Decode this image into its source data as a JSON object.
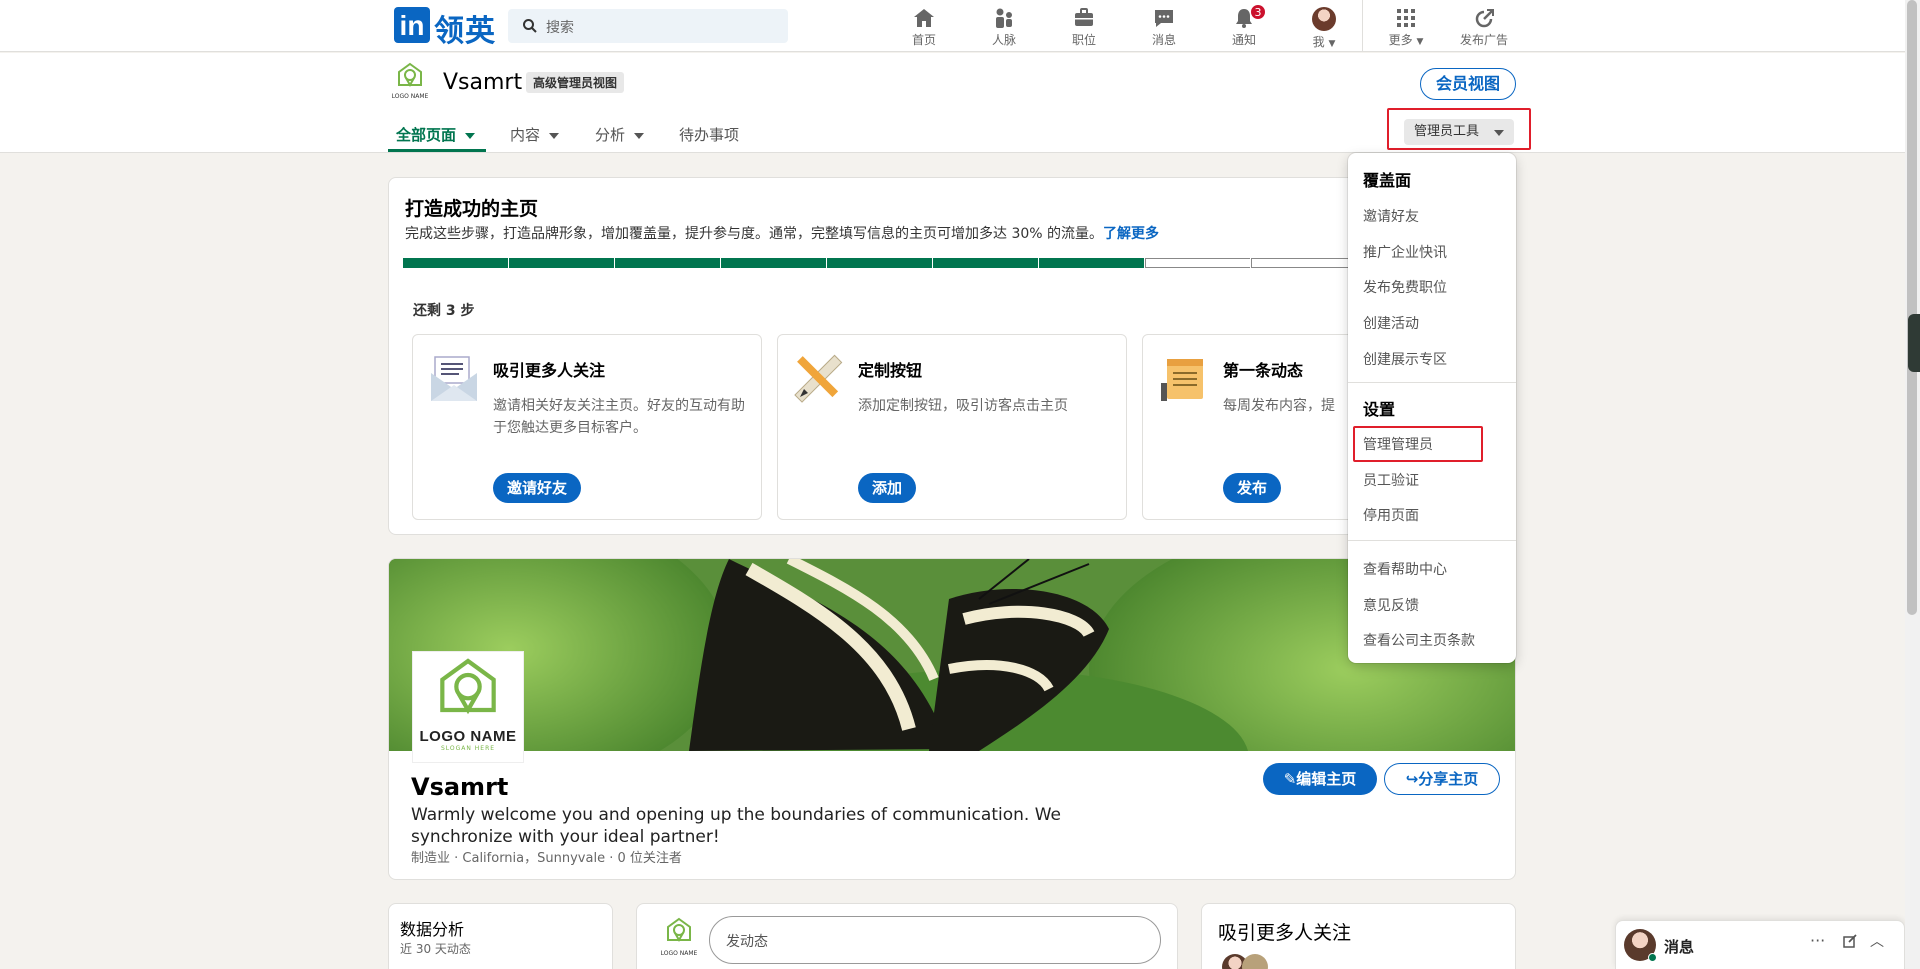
{
  "nav": {
    "logo_in": "in",
    "logo_text": "领英",
    "search_placeholder": "搜索",
    "items": [
      {
        "label": "首页",
        "icon": "home-icon"
      },
      {
        "label": "人脉",
        "icon": "network-icon"
      },
      {
        "label": "职位",
        "icon": "briefcase-icon"
      },
      {
        "label": "消息",
        "icon": "message-icon"
      },
      {
        "label": "通知",
        "icon": "bell-icon",
        "badge": "3"
      },
      {
        "label": "我",
        "icon": "avatar"
      },
      {
        "label": "更多",
        "icon": "grid-icon"
      },
      {
        "label": "发布广告",
        "icon": "ads-icon"
      }
    ]
  },
  "header": {
    "company_name": "Vsamrt",
    "view_badge": "高级管理员视图",
    "logo_caption": "LOGO NAME",
    "member_view": "会员视图",
    "tabs": [
      {
        "label": "全部页面",
        "active": true,
        "dropdown": true
      },
      {
        "label": "内容",
        "active": false,
        "dropdown": true
      },
      {
        "label": "分析",
        "active": false,
        "dropdown": true
      },
      {
        "label": "待办事项",
        "active": false,
        "dropdown": false
      }
    ],
    "admin_tools": "管理员工具"
  },
  "success_card": {
    "title": "打造成功的主页",
    "desc": "完成这些步骤，打造品牌形象，增加覆盖量，提升参与度。通常，完整填写信息的主页可增加多达 30% 的流量。",
    "learn_more": "了解更多",
    "progress": {
      "completed": 7,
      "total": 10
    },
    "remaining": "还剩 3 步",
    "steps": [
      {
        "title": "吸引更多人关注",
        "desc": "邀请相关好友关注主页。好友的互动有助于您触达更多目标客户。",
        "cta": "邀请好友",
        "icon": "envelope-icon"
      },
      {
        "title": "定制按钮",
        "desc": "添加定制按钮，吸引访客点击主页",
        "cta": "添加",
        "icon": "pencil-ruler-icon"
      },
      {
        "title": "第一条动态",
        "desc": "每周发布内容，提",
        "cta": "发布",
        "icon": "notepad-icon"
      }
    ]
  },
  "dropdown": {
    "sections": [
      {
        "heading": "覆盖面",
        "items": [
          "邀请好友",
          "推广企业快讯",
          "发布免费职位",
          "创建活动",
          "创建展示专区"
        ]
      },
      {
        "heading": "设置",
        "items": [
          "管理管理员",
          "员工验证",
          "停用页面"
        ]
      },
      {
        "heading": "",
        "items": [
          "查看帮助中心",
          "意见反馈",
          "查看公司主页条款"
        ]
      }
    ]
  },
  "profile": {
    "logo_name": "LOGO NAME",
    "slogan": "SLOGAN HERE",
    "name": "Vsamrt",
    "tagline": "Warmly welcome you and opening up the boundaries of communication. We synchronize with your ideal partner!",
    "meta": "制造业 · California，Sunnyvale · 0 位关注者",
    "edit_button": "编辑主页",
    "share_button": "分享主页"
  },
  "analytics": {
    "title": "数据分析",
    "subtitle": "近 30 天动态"
  },
  "composer": {
    "placeholder": "发动态",
    "logo_caption": "LOGO NAME"
  },
  "follow_card": {
    "title": "吸引更多人关注"
  },
  "messaging": {
    "label": "消息"
  },
  "colors": {
    "brand": "#0a66c2",
    "green": "#01754f",
    "highlight": "#e01e2b",
    "badge": "#cb112d"
  }
}
